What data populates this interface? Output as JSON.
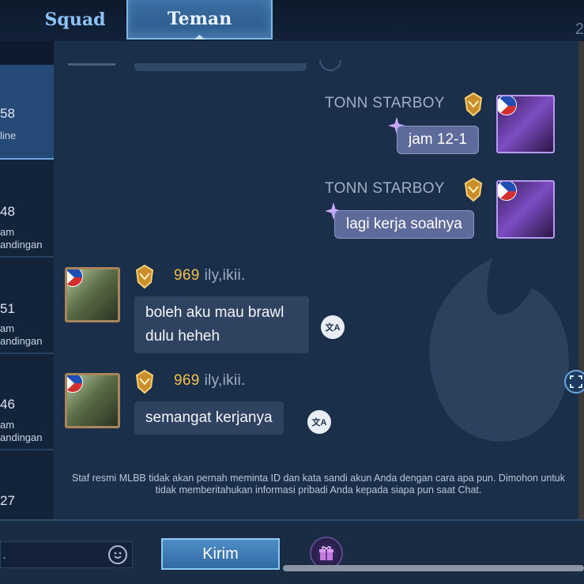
{
  "tabs": {
    "squad": "Squad",
    "teman": "Teman"
  },
  "top_right_char": "2",
  "friend_list": [
    {
      "num": "58",
      "sub1": "line",
      "sub2": ""
    },
    {
      "num": "48",
      "sub1": "am",
      "sub2": "andingan"
    },
    {
      "num": "51",
      "sub1": "am",
      "sub2": "andingan"
    },
    {
      "num": "46",
      "sub1": "am",
      "sub2": "andingan"
    },
    {
      "num": "27",
      "sub1": "",
      "sub2": ""
    }
  ],
  "messages": [
    {
      "side": "right",
      "name": "TONN STARBOY",
      "text": "jam 12-1"
    },
    {
      "side": "right",
      "name": "TONN STARBOY",
      "text": "lagi kerja soalnya"
    },
    {
      "side": "left",
      "level": "969",
      "name": "ily,ikii.",
      "line1": "boleh aku mau brawl",
      "line2": "dulu heheh"
    },
    {
      "side": "left",
      "level": "969",
      "name": "ily,ikii.",
      "line1": "semangat kerjanya"
    }
  ],
  "translate_label": "文A",
  "notice": "Staf resmi MLBB tidak akan pernah meminta ID dan kata sandi akun Anda dengan cara apa pun. Dimohon untuk tidak memberitahukan informasi pribadi Anda kepada siapa pun saat Chat.",
  "input": {
    "placeholder": "."
  },
  "send_label": "Kirim",
  "colors": {
    "accent": "#4f8ec6",
    "bubble_right": "#5d6a9a",
    "bubble_left": "#2f4361",
    "level": "#f2c04a"
  },
  "icons": [
    "emoji-icon",
    "gift-icon",
    "translate-icon",
    "rank-badge-icon",
    "flag-icon",
    "expand-icon"
  ]
}
